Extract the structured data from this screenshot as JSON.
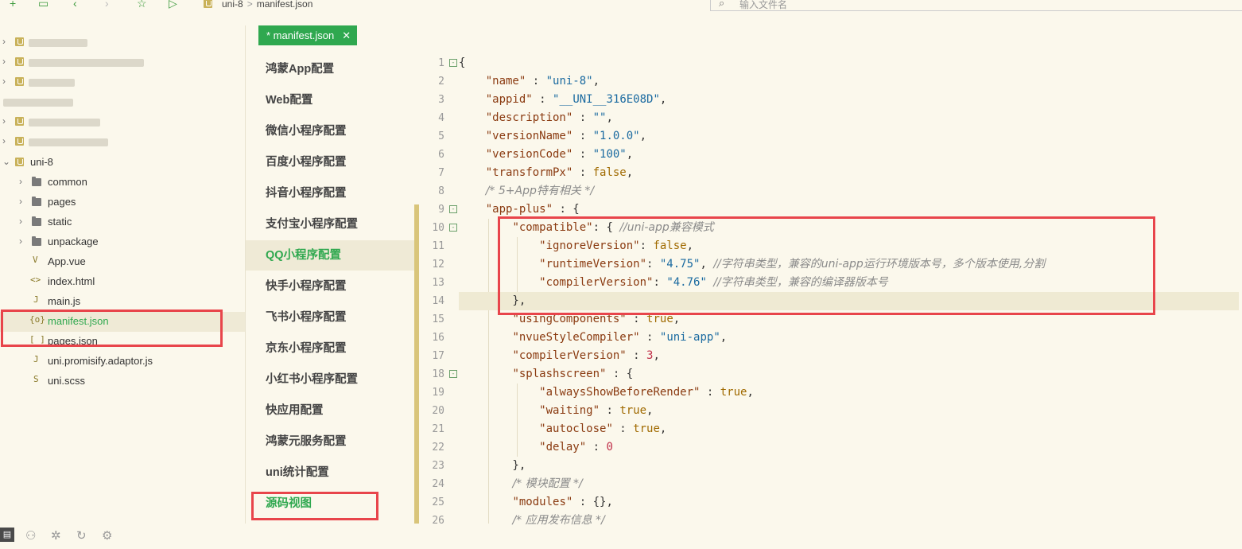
{
  "toolbar": {
    "breadcrumb": [
      "uni-8",
      "manifest.json"
    ],
    "search_placeholder": "输入文件名"
  },
  "explorer": {
    "project": "uni-8",
    "items": [
      {
        "type": "folder",
        "label": "common"
      },
      {
        "type": "folder",
        "label": "pages"
      },
      {
        "type": "folder",
        "label": "static"
      },
      {
        "type": "folder",
        "label": "unpackage"
      },
      {
        "type": "file",
        "label": "App.vue",
        "icon": "V"
      },
      {
        "type": "file",
        "label": "index.html",
        "icon": "<>"
      },
      {
        "type": "file",
        "label": "main.js",
        "icon": "J"
      },
      {
        "type": "file",
        "label": "manifest.json",
        "icon": "{o}"
      },
      {
        "type": "file",
        "label": "pages.json",
        "icon": "[ ]"
      },
      {
        "type": "file",
        "label": "uni.promisify.adaptor.js",
        "icon": "J"
      },
      {
        "type": "file",
        "label": "uni.scss",
        "icon": "S"
      }
    ]
  },
  "tab": {
    "label": "* manifest.json",
    "close": "✕"
  },
  "config_menu": [
    "鸿蒙App配置",
    "Web配置",
    "微信小程序配置",
    "百度小程序配置",
    "抖音小程序配置",
    "支付宝小程序配置",
    "QQ小程序配置",
    "快手小程序配置",
    "飞书小程序配置",
    "京东小程序配置",
    "小红书小程序配置",
    "快应用配置",
    "鸿蒙元服务配置",
    "uni统计配置",
    "源码视图"
  ],
  "code_lines": [
    {
      "n": 1,
      "fold": "-",
      "text": "{"
    },
    {
      "n": 2,
      "text": "    \"name\" : \"uni-8\","
    },
    {
      "n": 3,
      "text": "    \"appid\" : \"__UNI__316E08D\","
    },
    {
      "n": 4,
      "text": "    \"description\" : \"\","
    },
    {
      "n": 5,
      "text": "    \"versionName\" : \"1.0.0\","
    },
    {
      "n": 6,
      "text": "    \"versionCode\" : \"100\","
    },
    {
      "n": 7,
      "text": "    \"transformPx\" : false,"
    },
    {
      "n": 8,
      "text": "    /* 5+App特有相关 */"
    },
    {
      "n": 9,
      "fold": "-",
      "text": "    \"app-plus\" : {"
    },
    {
      "n": 10,
      "fold": "-",
      "text": "        \"compatible\": { //uni-app兼容模式"
    },
    {
      "n": 11,
      "text": "            \"ignoreVersion\": false,"
    },
    {
      "n": 12,
      "text": "            \"runtimeVersion\": \"4.75\", //字符串类型，兼容的uni-app运行环境版本号，多个版本使用,分割"
    },
    {
      "n": 13,
      "text": "            \"compilerVersion\": \"4.76\" //字符串类型，兼容的编译器版本号"
    },
    {
      "n": 14,
      "text": "        },"
    },
    {
      "n": 15,
      "text": "        \"usingComponents\" : true,"
    },
    {
      "n": 16,
      "text": "        \"nvueStyleCompiler\" : \"uni-app\","
    },
    {
      "n": 17,
      "text": "        \"compilerVersion\" : 3,"
    },
    {
      "n": 18,
      "fold": "-",
      "text": "        \"splashscreen\" : {"
    },
    {
      "n": 19,
      "text": "            \"alwaysShowBeforeRender\" : true,"
    },
    {
      "n": 20,
      "text": "            \"waiting\" : true,"
    },
    {
      "n": 21,
      "text": "            \"autoclose\" : true,"
    },
    {
      "n": 22,
      "text": "            \"delay\" : 0"
    },
    {
      "n": 23,
      "text": "        },"
    },
    {
      "n": 24,
      "text": "        /* 模块配置 */"
    },
    {
      "n": 25,
      "text": "        \"modules\" : {},"
    },
    {
      "n": 26,
      "text": "        /* 应用发布信息 */"
    }
  ],
  "colors": {
    "accent": "#2fa84f",
    "annotation": "#e8454b",
    "background": "#fbf8ec"
  }
}
